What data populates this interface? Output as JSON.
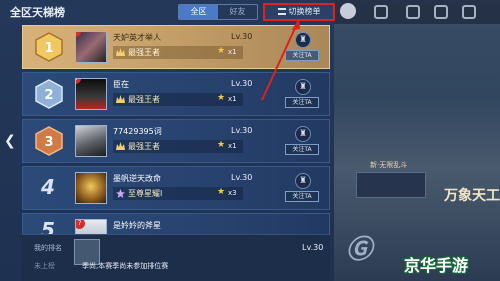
{
  "panel": {
    "title": "全区天梯榜",
    "tabs": [
      {
        "label": "全区",
        "active": true
      },
      {
        "label": "好友",
        "active": false
      }
    ],
    "switch_button": "切换榜单"
  },
  "rows": [
    {
      "rank": "1",
      "badge": "7",
      "name": "天妒英才举人",
      "tier": "最强王者",
      "stars": "x1",
      "level": "Lv.30",
      "follow": "关注TA"
    },
    {
      "rank": "2",
      "badge": "8",
      "name": "臣在",
      "tier": "最强王者",
      "stars": "x1",
      "level": "Lv.30",
      "follow": "关注TA"
    },
    {
      "rank": "3",
      "badge": "",
      "name": "77429395词",
      "tier": "最强王者",
      "stars": "x1",
      "level": "Lv.30",
      "follow": "关注TA"
    },
    {
      "rank": "4",
      "badge": "",
      "name": "墨帆逆天改命",
      "tier": "至尊星耀I",
      "stars": "x3",
      "level": "Lv.30",
      "follow": "关注TA"
    },
    {
      "rank": "5",
      "badge": "7",
      "name": "是妗妗的斧星",
      "tier": "",
      "stars": "",
      "level": "",
      "follow": ""
    }
  ],
  "my_rank": {
    "label": "我的排名",
    "status": "未上榜",
    "message": "季尚,本赛季尚未参加排位赛",
    "level": "Lv.30"
  },
  "scene": {
    "banner_text": "万象天工",
    "chip_text": "新·无限乱斗"
  },
  "watermark": "京华手游",
  "colors": {
    "highlight_red": "#e0201e",
    "active_tab": "#4a7ac8",
    "gold_row": "#d7b27a"
  }
}
